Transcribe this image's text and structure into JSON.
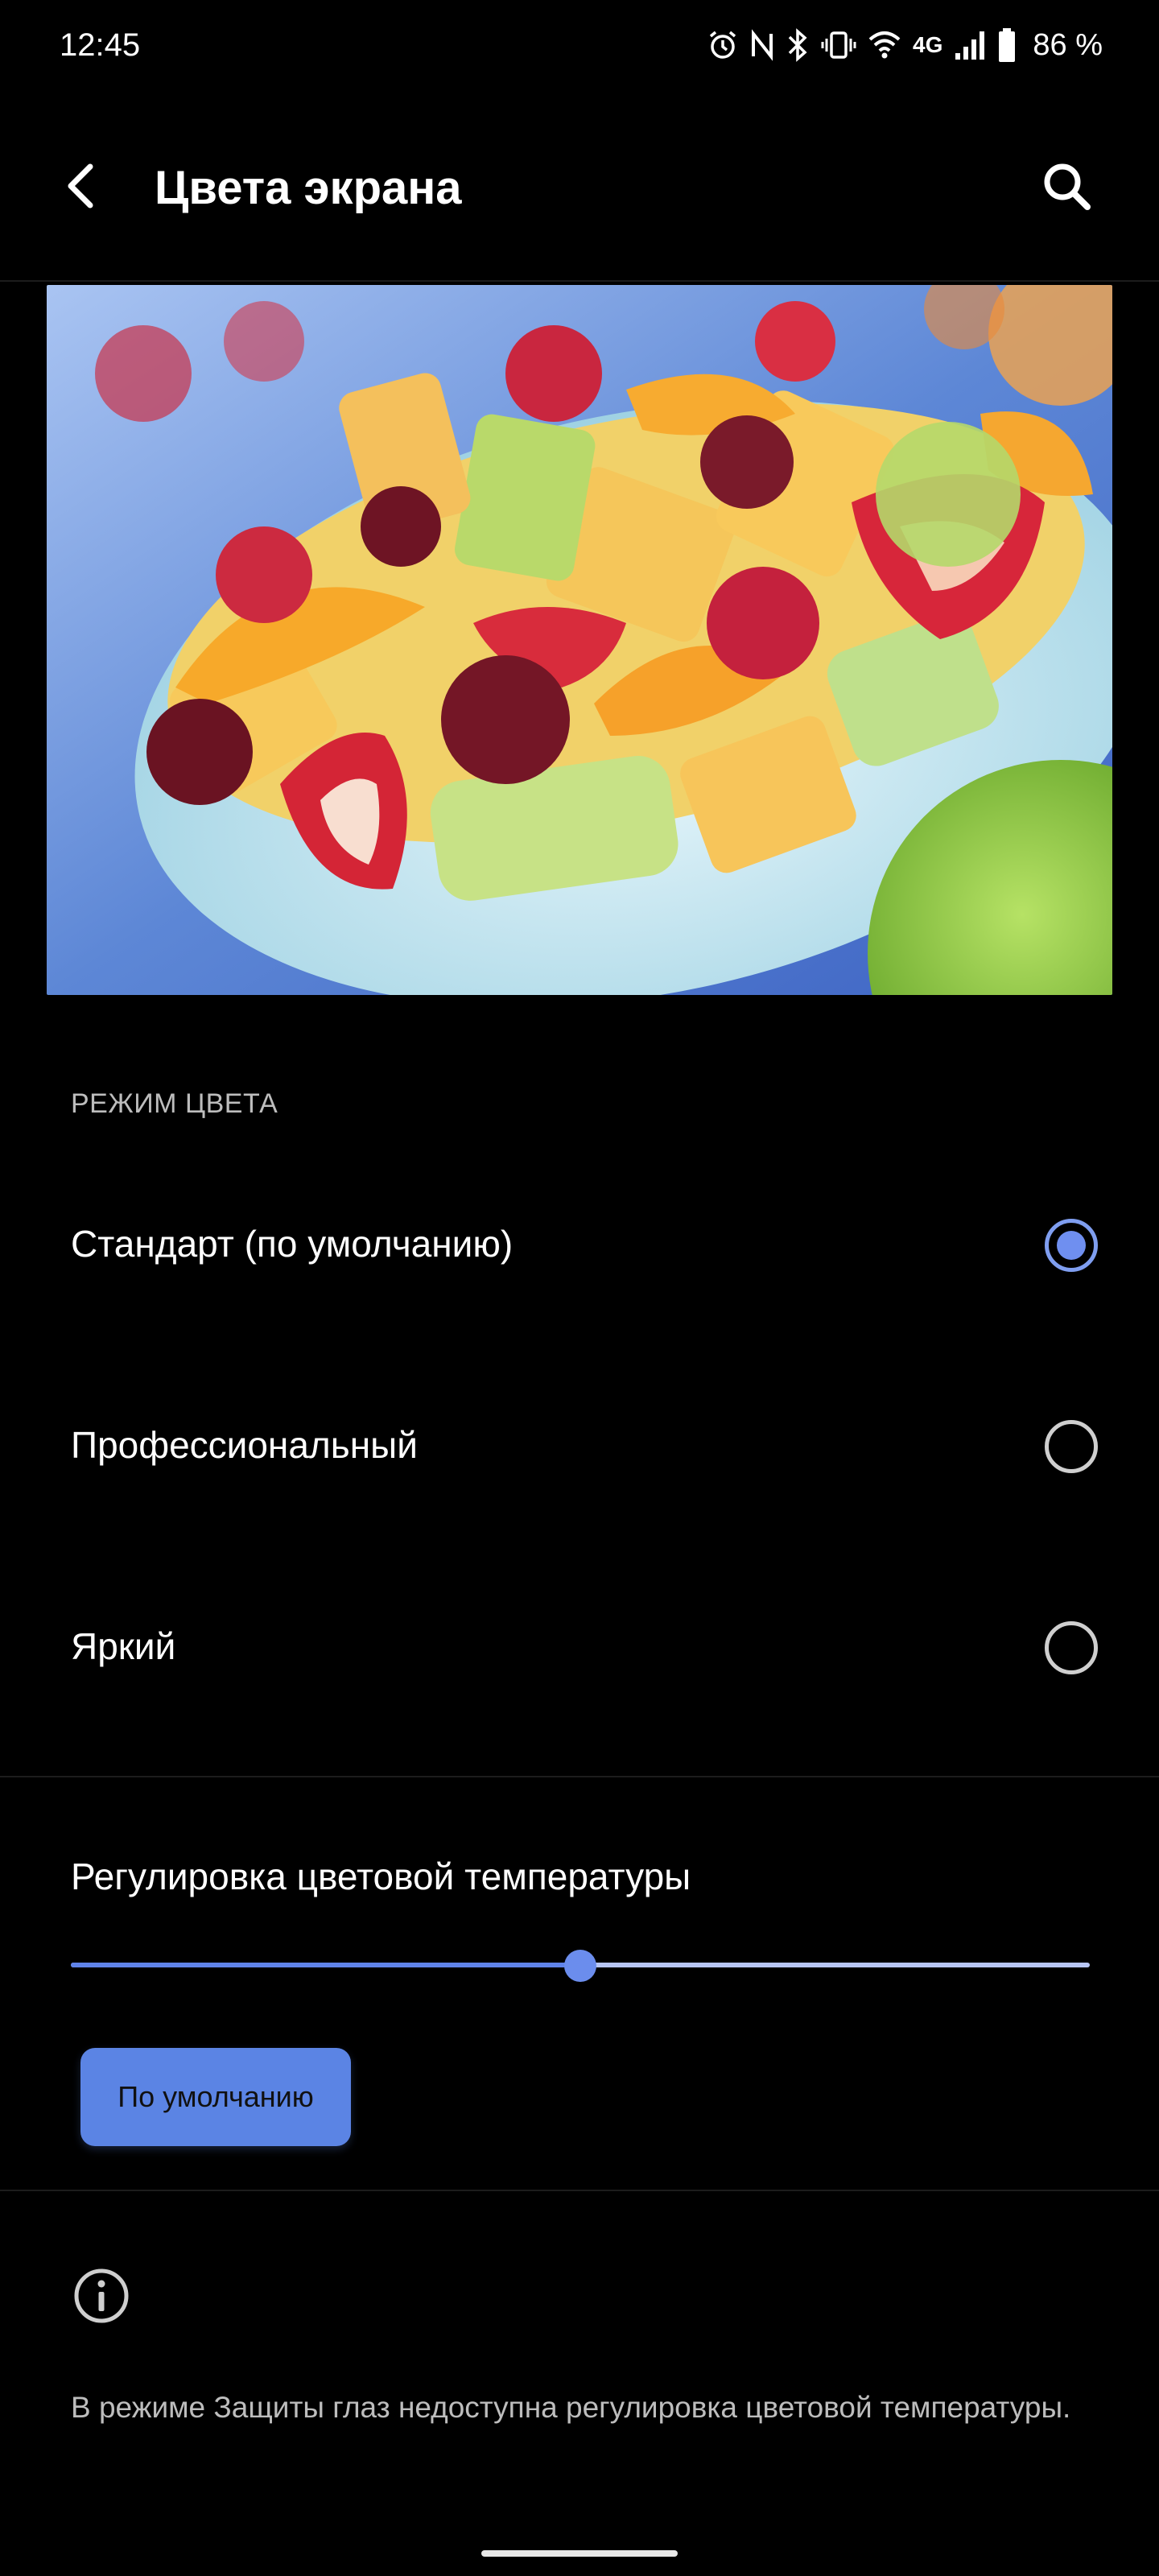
{
  "status_bar": {
    "time": "12:45",
    "network": "4G",
    "battery": "86 %",
    "icons": [
      "alarm-icon",
      "nfc-icon",
      "bluetooth-icon",
      "vibrate-icon",
      "wifi-icon",
      "signal-icon",
      "battery-icon"
    ]
  },
  "app_bar": {
    "title": "Цвета экрана",
    "back_icon": "back-arrow-icon",
    "search_icon": "search-icon"
  },
  "preview": {
    "icon": "fruit-salad-image"
  },
  "color_mode": {
    "header": "РЕЖИМ ЦВЕТА",
    "options": [
      {
        "label": "Стандарт (по умолчанию)",
        "selected": true
      },
      {
        "label": "Профессиональный",
        "selected": false
      },
      {
        "label": "Яркий",
        "selected": false
      }
    ]
  },
  "temperature": {
    "label": "Регулировка цветовой температуры",
    "value_fraction": 0.5,
    "default_button": "По умолчанию"
  },
  "info": {
    "icon": "info-icon",
    "text": "В режиме Защиты глаз недоступна регулировка цветовой температуры."
  },
  "colors": {
    "accent": "#6f8ff0",
    "background": "#000000",
    "button": "#5b84e4"
  }
}
